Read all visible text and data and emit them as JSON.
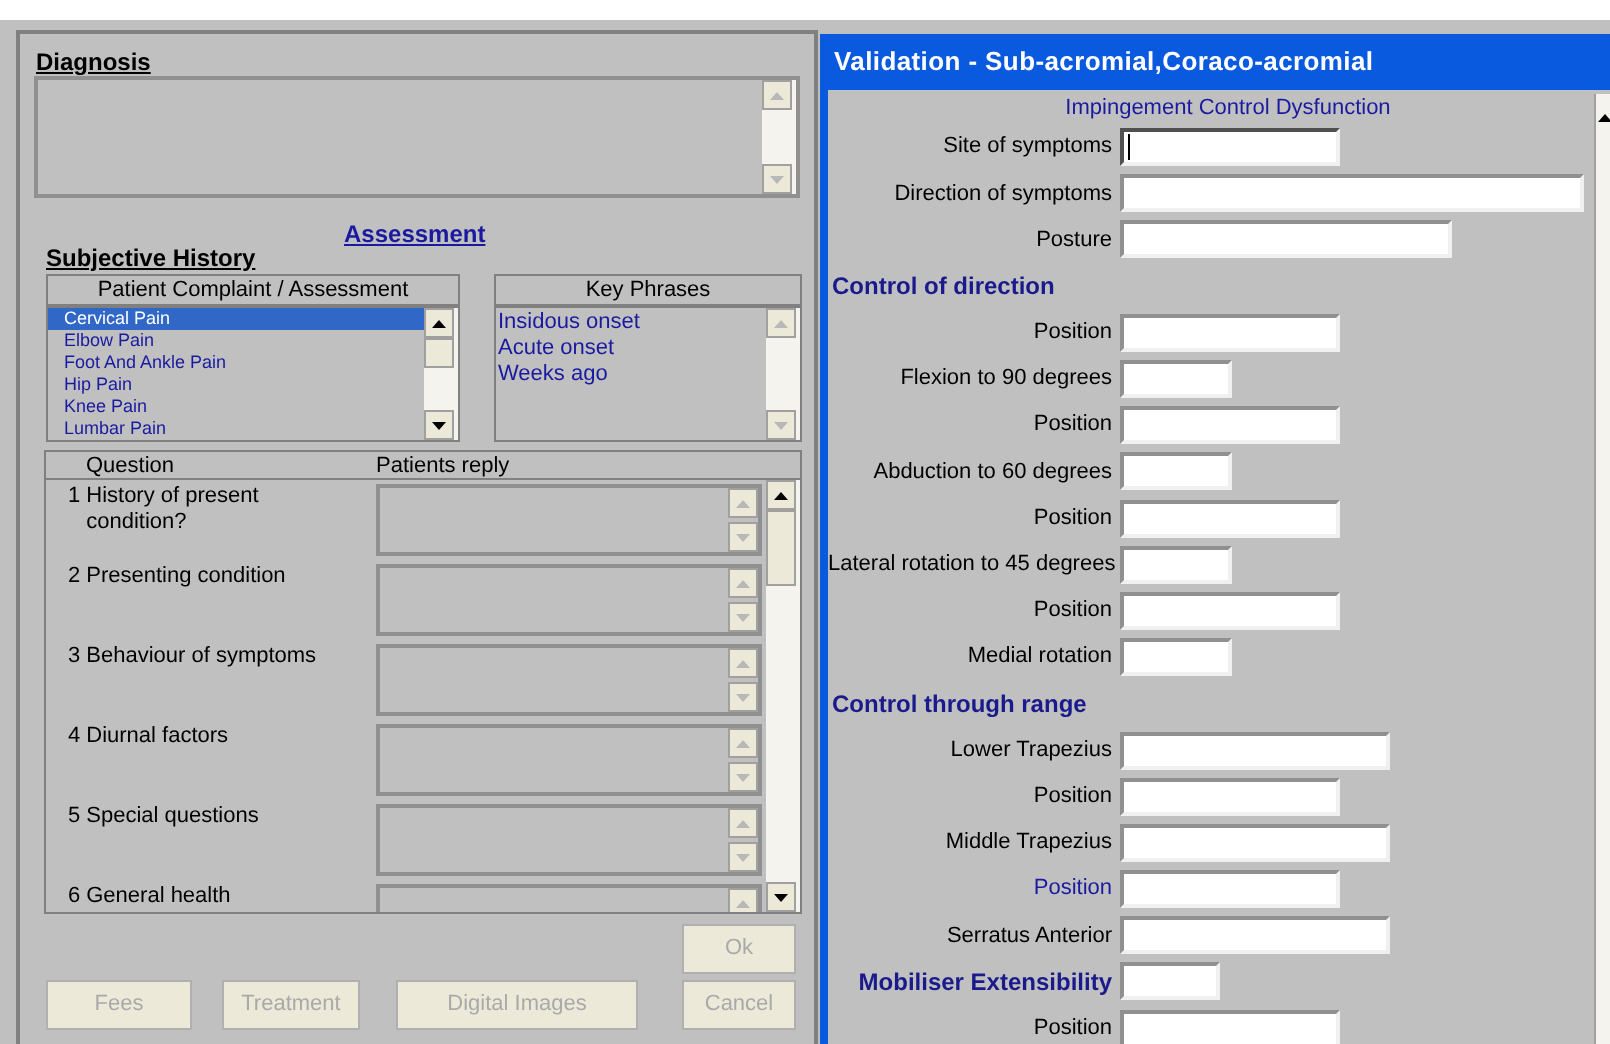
{
  "left_window": {
    "diagnosis": {
      "label": "Diagnosis"
    },
    "assessment_title": "Assessment",
    "subjective_history": "Subjective History",
    "complaint_list": {
      "header": "Patient Complaint / Assessment",
      "items": [
        {
          "label": "Cervical Pain",
          "selected": true
        },
        {
          "label": "Elbow Pain",
          "selected": false
        },
        {
          "label": "Foot And Ankle Pain",
          "selected": false
        },
        {
          "label": "Hip Pain",
          "selected": false
        },
        {
          "label": "Knee Pain",
          "selected": false
        },
        {
          "label": "Lumbar Pain",
          "selected": false
        }
      ]
    },
    "key_phrases": {
      "header": "Key Phrases",
      "items": [
        "Insidous onset",
        "Acute onset",
        "Weeks ago"
      ]
    },
    "questions": {
      "columns": [
        "Question",
        "Patients reply"
      ],
      "rows": [
        {
          "number": "1",
          "text": "History of present condition?"
        },
        {
          "number": "2",
          "text": "Presenting condition"
        },
        {
          "number": "3",
          "text": "Behaviour of symptoms"
        },
        {
          "number": "4",
          "text": "Diurnal factors"
        },
        {
          "number": "5",
          "text": "Special questions"
        },
        {
          "number": "6",
          "text": "General health"
        }
      ]
    },
    "buttons": [
      {
        "label": "Ok",
        "disabled": true
      },
      {
        "label": "Fees",
        "disabled": true
      },
      {
        "label": "Treatment",
        "disabled": true
      },
      {
        "label": "Digital Images",
        "disabled": true
      },
      {
        "label": "Cancel",
        "disabled": true
      }
    ]
  },
  "right_window": {
    "title": "Validation - Sub-acromial,Coraco-acromial",
    "subtitle": "Impingement Control Dysfunction",
    "rows": [
      {
        "kind": "field",
        "label": "Site of symptoms",
        "focused": true
      },
      {
        "kind": "field",
        "label": "Direction of symptoms",
        "focused": false
      },
      {
        "kind": "field",
        "label": "Posture",
        "focused": false
      },
      {
        "kind": "heading",
        "label": "Control of direction"
      },
      {
        "kind": "field",
        "label": "Position",
        "focused": false
      },
      {
        "kind": "field",
        "label": "Flexion to 90 degrees",
        "focused": false
      },
      {
        "kind": "field",
        "label": "Position",
        "focused": false
      },
      {
        "kind": "field",
        "label": "Abduction to 60 degrees",
        "focused": false
      },
      {
        "kind": "field",
        "label": "Position",
        "focused": false
      },
      {
        "kind": "field",
        "label": "Lateral rotation to 45 degrees",
        "focused": false
      },
      {
        "kind": "field",
        "label": "Position",
        "focused": false
      },
      {
        "kind": "field",
        "label": "Medial rotation",
        "focused": false
      },
      {
        "kind": "heading",
        "label": "Control through range"
      },
      {
        "kind": "field",
        "label": "Lower Trapezius",
        "focused": false
      },
      {
        "kind": "field",
        "label": "Position",
        "focused": false
      },
      {
        "kind": "field",
        "label": "Middle Trapezius",
        "focused": false
      },
      {
        "kind": "accent-field",
        "label": "Position",
        "focused": false
      },
      {
        "kind": "field",
        "label": "Serratus Anterior",
        "focused": false
      },
      {
        "kind": "bold-field",
        "label": "Mobiliser Extensibility",
        "focused": false
      },
      {
        "kind": "field",
        "label": "Position",
        "focused": false
      }
    ]
  }
}
